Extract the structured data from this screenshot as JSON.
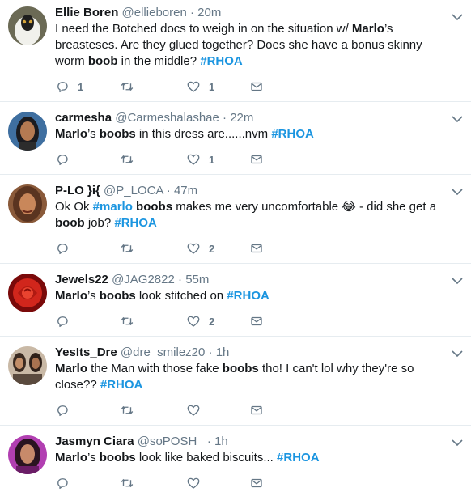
{
  "colors": {
    "accent": "#1b95e0",
    "muted": "#657786",
    "text": "#14171a",
    "divider": "#e6ecf0"
  },
  "tweets": [
    {
      "name": "Ellie Boren",
      "handle": "@ellieboren",
      "time": "20m",
      "segments": [
        {
          "t": "I need the Botched docs to weigh in on the situation w/ "
        },
        {
          "t": "Marlo",
          "b": true
        },
        {
          "t": "’s breasteses. Are they glued together? Does she have a bonus skinny worm "
        },
        {
          "t": "boob",
          "b": true
        },
        {
          "t": " in the middle? "
        },
        {
          "t": "#RHOA",
          "tag": true
        }
      ],
      "reply_count": "1",
      "retweet_count": "",
      "like_count": "1",
      "avatar_icon": "lemur-avatar-icon"
    },
    {
      "name": "carmesha",
      "handle": "@Carmeshalashae",
      "time": "22m",
      "segments": [
        {
          "t": "Marlo",
          "b": true
        },
        {
          "t": "’s "
        },
        {
          "t": "boobs",
          "b": true
        },
        {
          "t": " in this dress are......nvm "
        },
        {
          "t": "#RHOA",
          "tag": true
        }
      ],
      "reply_count": "",
      "retweet_count": "",
      "like_count": "1",
      "avatar_icon": "woman-avatar-icon"
    },
    {
      "name": "P-LO }i{",
      "handle": "@P_LOCA",
      "time": "47m",
      "segments": [
        {
          "t": "Ok Ok "
        },
        {
          "t": "#marlo",
          "tag": true
        },
        {
          "t": " "
        },
        {
          "t": "boobs",
          "b": true
        },
        {
          "t": " makes me very uncomfortable 😂 - did she get a "
        },
        {
          "t": "boob",
          "b": true
        },
        {
          "t": " job? "
        },
        {
          "t": "#RHOA",
          "tag": true
        }
      ],
      "reply_count": "",
      "retweet_count": "",
      "like_count": "2",
      "avatar_icon": "woman-avatar-icon"
    },
    {
      "name": "Jewels22",
      "handle": "@JAG2822",
      "time": "55m",
      "segments": [
        {
          "t": "Marlo",
          "b": true
        },
        {
          "t": "’s "
        },
        {
          "t": "boobs",
          "b": true
        },
        {
          "t": " look stitched on "
        },
        {
          "t": "#RHOA",
          "tag": true
        }
      ],
      "reply_count": "",
      "retweet_count": "",
      "like_count": "2",
      "avatar_icon": "rose-avatar-icon"
    },
    {
      "name": "YesIts_Dre",
      "handle": "@dre_smilez20",
      "time": "1h",
      "segments": [
        {
          "t": "Marlo",
          "b": true
        },
        {
          "t": " the Man with those fake "
        },
        {
          "t": "boobs",
          "b": true
        },
        {
          "t": " tho! I can't lol why they're so close?? "
        },
        {
          "t": "#RHOA",
          "tag": true
        }
      ],
      "reply_count": "",
      "retweet_count": "",
      "like_count": "",
      "avatar_icon": "group-avatar-icon"
    },
    {
      "name": "Jasmyn Ciara",
      "handle": "@soPOSH_",
      "time": "1h",
      "segments": [
        {
          "t": "Marlo",
          "b": true
        },
        {
          "t": "’s "
        },
        {
          "t": "boobs",
          "b": true
        },
        {
          "t": " look like baked biscuits... "
        },
        {
          "t": "#RHOA",
          "tag": true
        }
      ],
      "reply_count": "",
      "retweet_count": "",
      "like_count": "",
      "avatar_icon": "woman-avatar-icon"
    }
  ]
}
